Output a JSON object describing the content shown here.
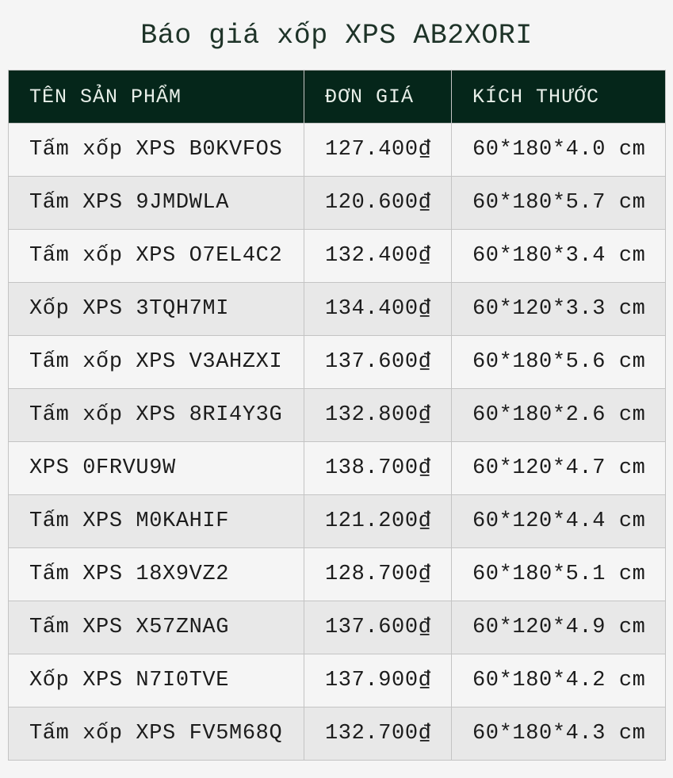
{
  "title": "Báo giá xốp XPS AB2XORI",
  "headers": {
    "name": "TÊN SẢN PHẨM",
    "price": "ĐƠN GIÁ",
    "size": "KÍCH THƯỚC"
  },
  "rows": [
    {
      "name": "Tấm xốp XPS B0KVFOS",
      "price": "127.400₫",
      "size": "60*180*4.0 cm"
    },
    {
      "name": "Tấm XPS 9JMDWLA",
      "price": "120.600₫",
      "size": "60*180*5.7 cm"
    },
    {
      "name": "Tấm xốp XPS O7EL4C2",
      "price": "132.400₫",
      "size": "60*180*3.4 cm"
    },
    {
      "name": "Xốp XPS 3TQH7MI",
      "price": "134.400₫",
      "size": "60*120*3.3 cm"
    },
    {
      "name": "Tấm xốp XPS V3AHZXI",
      "price": "137.600₫",
      "size": "60*180*5.6 cm"
    },
    {
      "name": "Tấm xốp XPS 8RI4Y3G",
      "price": "132.800₫",
      "size": "60*180*2.6 cm"
    },
    {
      "name": "XPS 0FRVU9W",
      "price": "138.700₫",
      "size": "60*120*4.7 cm"
    },
    {
      "name": "Tấm XPS M0KAHIF",
      "price": "121.200₫",
      "size": "60*120*4.4 cm"
    },
    {
      "name": "Tấm XPS 18X9VZ2",
      "price": "128.700₫",
      "size": "60*180*5.1 cm"
    },
    {
      "name": "Tấm XPS X57ZNAG",
      "price": "137.600₫",
      "size": "60*120*4.9 cm"
    },
    {
      "name": "Xốp XPS N7I0TVE",
      "price": "137.900₫",
      "size": "60*180*4.2 cm"
    },
    {
      "name": "Tấm xốp XPS FV5M68Q",
      "price": "132.700₫",
      "size": "60*180*4.3 cm"
    }
  ],
  "colors": {
    "header_bg": "#05261a",
    "title_text": "#1e3328",
    "row_odd": "#f5f5f5",
    "row_even": "#e8e8e8"
  }
}
